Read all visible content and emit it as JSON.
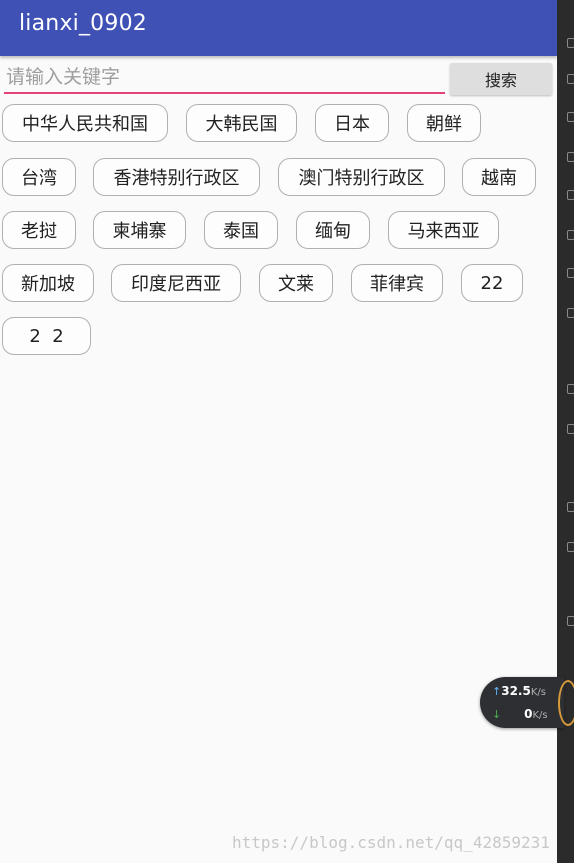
{
  "app": {
    "title": "lianxi_0902"
  },
  "search": {
    "placeholder": "请输入关键字",
    "value": "",
    "button_label": "搜索"
  },
  "tags": [
    "中华人民共和国",
    "大韩民国",
    "日本",
    "朝鲜",
    "台湾",
    "香港特别行政区",
    "澳门特别行政区",
    "越南",
    "老挝",
    "柬埔寨",
    "泰国",
    "缅甸",
    "马来西亚",
    "新加坡",
    "印度尼西亚",
    "文莱",
    "菲律宾",
    "22",
    "2  2"
  ],
  "net_speed": {
    "up_value": "32.5",
    "up_unit": "K/s",
    "down_value": "0",
    "down_unit": "K/s"
  },
  "watermark": "https://blog.csdn.net/qq_42859231",
  "colors": {
    "appbar": "#3f51b5",
    "input_underline": "#e4407a",
    "button_bg": "#dedede"
  },
  "icons": {
    "upload": "arrow-up-icon",
    "download": "arrow-down-icon"
  }
}
